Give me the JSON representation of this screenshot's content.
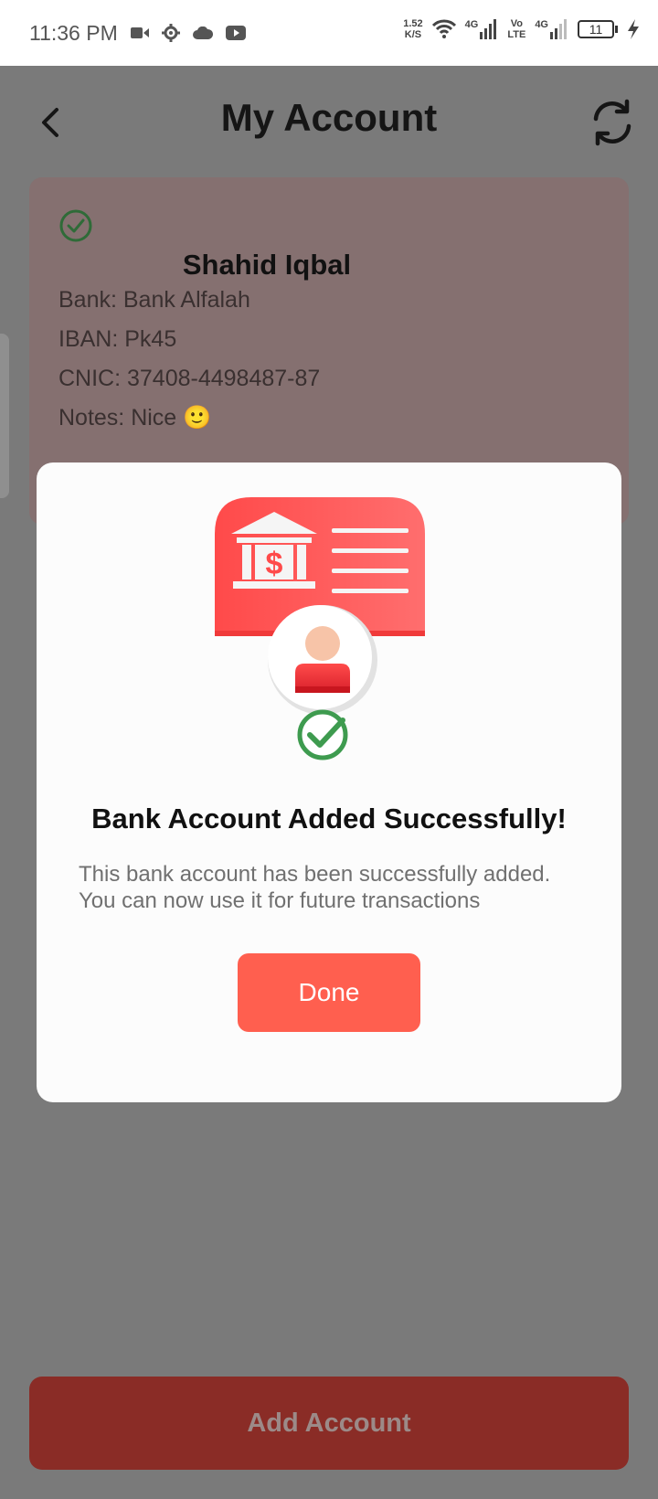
{
  "status_bar": {
    "time": "11:36 PM",
    "net_speed_value": "1.52",
    "net_speed_unit": "K/S",
    "signal1_label": "4G",
    "volte_top": "Vo",
    "volte_bottom": "LTE",
    "signal2_label": "4G",
    "battery": "11",
    "icons": [
      "video-camera-icon",
      "settings-gear-icon",
      "cloud-icon",
      "youtube-icon",
      "wifi-icon",
      "signal-icon",
      "battery-icon",
      "charging-icon"
    ]
  },
  "header": {
    "title": "My Account",
    "back_icon": "back-arrow-icon",
    "refresh_icon": "refresh-icon"
  },
  "account_card": {
    "name": "Shahid Iqbal",
    "bank": "Bank: Bank Alfalah",
    "iban": "IBAN: Pk45",
    "cnic": "CNIC: 37408-4498487-87",
    "notes": "Notes: Nice 🙂"
  },
  "dialog": {
    "title": "Bank Account Added Successfully!",
    "message": "This bank account has been successfully added. You can now use it for future transactions",
    "done_label": "Done"
  },
  "footer": {
    "add_account_label": "Add Account"
  },
  "colors": {
    "accent": "#ff5f4f",
    "success": "#3e9b4f",
    "overlay": "#7a7a7a"
  }
}
